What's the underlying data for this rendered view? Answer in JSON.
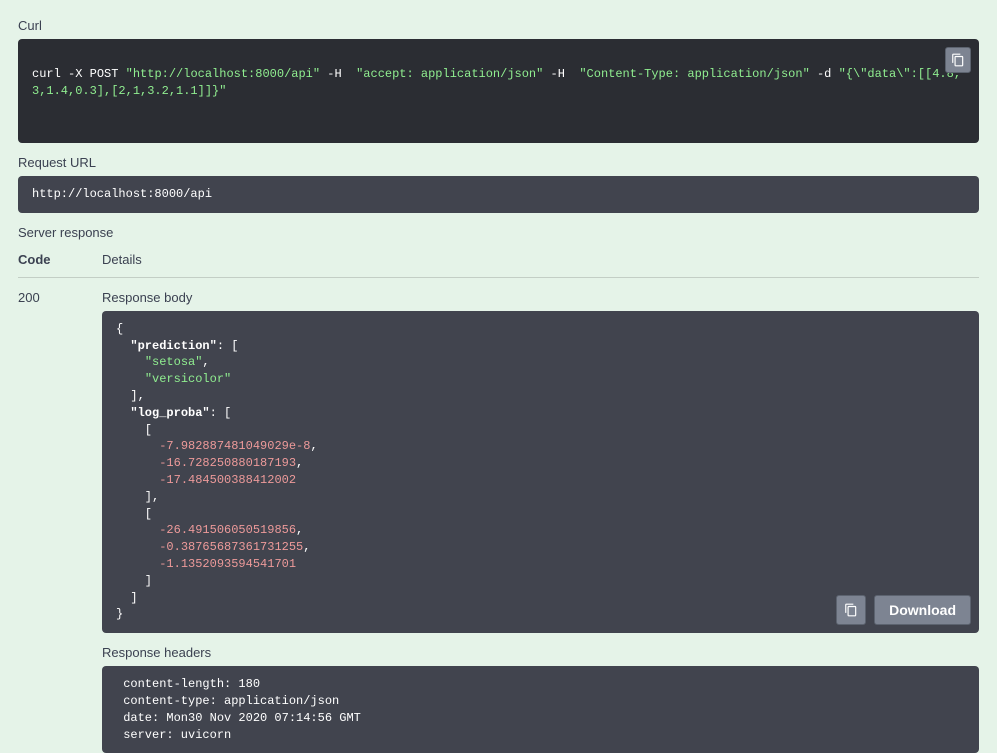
{
  "labels": {
    "curl": "Curl",
    "request_url": "Request URL",
    "server_response": "Server response",
    "code": "Code",
    "details": "Details",
    "response_body": "Response body",
    "response_headers": "Response headers",
    "download": "Download"
  },
  "curl": {
    "cmd": "curl",
    "flag_x": "-X",
    "method": "POST",
    "url": "\"http://localhost:8000/api\"",
    "flag_h1": "-H",
    "h1": "\"accept: application/json\"",
    "flag_h2": "-H",
    "h2": "\"Content-Type: application/json\"",
    "flag_d": "-d",
    "body": "\"{\\\"data\\\":[[4.8,3,1.4,0.3],[2,1,3.2,1.1]]}\""
  },
  "request_url": "http://localhost:8000/api",
  "response": {
    "code": "200",
    "body": {
      "prediction": [
        "setosa",
        "versicolor"
      ],
      "log_proba": [
        [
          -7.982887481049029e-08,
          -16.728250880187193,
          -17.484500388412002
        ],
        [
          -26.491506050519856,
          -0.38765687361731255,
          -1.1352093594541701
        ]
      ]
    },
    "headers_text": " content-length: 180 \n content-type: application/json \n date: Mon30 Nov 2020 07:14:56 GMT \n server: uvicorn "
  }
}
